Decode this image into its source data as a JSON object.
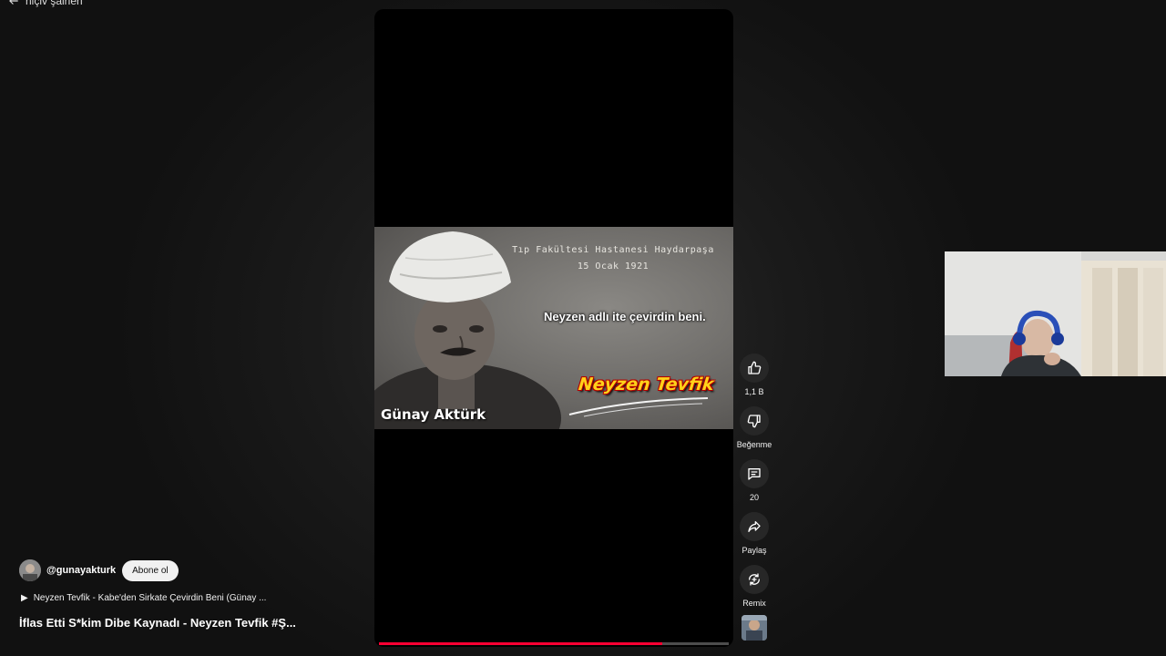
{
  "nav": {
    "back_label": "hiçiv şairleri"
  },
  "video": {
    "overlay_line1": "Tıp Fakültesi Hastanesi Haydarpaşa",
    "overlay_line2": "15 Ocak 1921",
    "quote": "Neyzen adlı ite çevirdin beni.",
    "name_caption": "Neyzen Tevfik",
    "watermark": "Günay Aktürk",
    "progress_percent": 81
  },
  "actions": {
    "like_count": "1,1 B",
    "dislike_label": "Beğenme",
    "comment_count": "20",
    "share_label": "Paylaş",
    "remix_label": "Remix"
  },
  "channel": {
    "handle": "@gunayakturk",
    "subscribe_label": "Abone ol"
  },
  "music": {
    "icon": "▶",
    "text": "Neyzen Tevfik - Kabe'den Sirkate Çevirdin Beni (Günay ..."
  },
  "title": "İflas Etti S*kim Dibe Kaynadı - Neyzen Tevfik #Ş...",
  "colors": {
    "progress": "#ff0033",
    "name_caption": "#ffd21a",
    "background": "#111111"
  }
}
